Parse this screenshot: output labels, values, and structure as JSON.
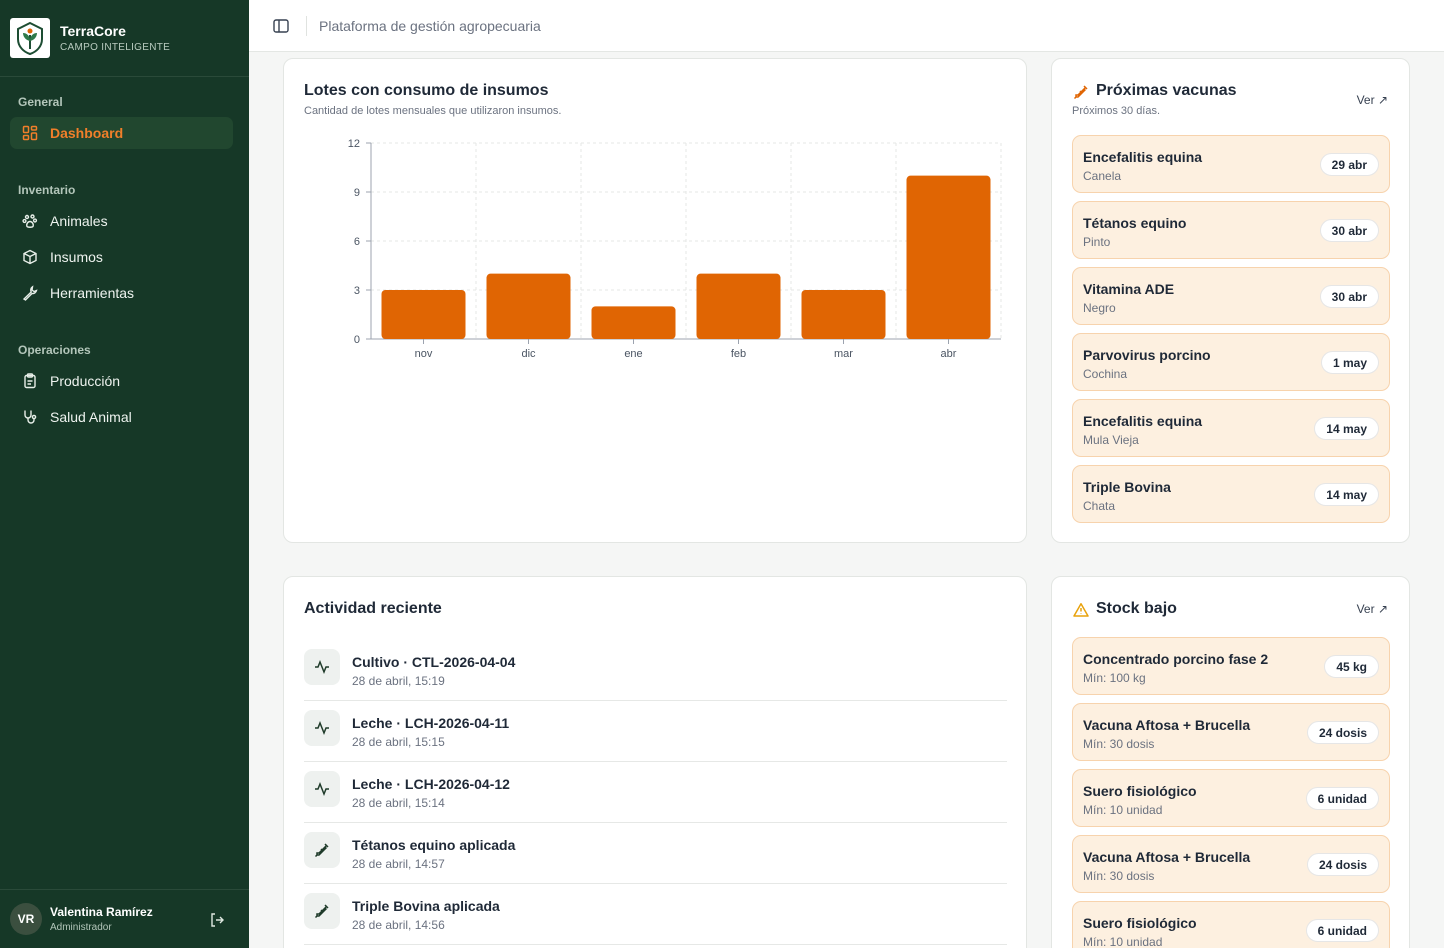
{
  "brand": {
    "name": "TerraCore",
    "tagline": "CAMPO INTELIGENTE"
  },
  "sidebar": {
    "sections": [
      {
        "title": "General",
        "items": [
          {
            "label": "Dashboard",
            "icon": "dashboard-icon",
            "active": true
          }
        ]
      },
      {
        "title": "Inventario",
        "items": [
          {
            "label": "Animales",
            "icon": "paw-icon"
          },
          {
            "label": "Insumos",
            "icon": "box-icon"
          },
          {
            "label": "Herramientas",
            "icon": "wrench-icon"
          }
        ]
      },
      {
        "title": "Operaciones",
        "items": [
          {
            "label": "Producción",
            "icon": "clipboard-icon"
          },
          {
            "label": "Salud Animal",
            "icon": "stethoscope-icon"
          }
        ]
      }
    ]
  },
  "user": {
    "initials": "VR",
    "name": "Valentina Ramírez",
    "role": "Administrador"
  },
  "header": {
    "title": "Plataforma de gestión agropecuaria"
  },
  "consumo": {
    "title": "Lotes con consumo de insumos",
    "subtitle": "Cantidad de lotes mensuales que utilizaron insumos."
  },
  "chart_data": {
    "type": "bar",
    "categories": [
      "nov",
      "dic",
      "ene",
      "feb",
      "mar",
      "abr"
    ],
    "values": [
      3,
      4,
      2,
      4,
      3,
      10
    ],
    "yticks": [
      0,
      3,
      6,
      9,
      12
    ],
    "ylim": [
      0,
      12
    ],
    "grid": true,
    "color": "#e06503"
  },
  "vacunas": {
    "title": "Próximas vacunas",
    "subtitle": "Próximos 30 días.",
    "link": "Ver ↗",
    "items": [
      {
        "name": "Encefalitis equina",
        "animal": "Canela",
        "date": "29 abr"
      },
      {
        "name": "Tétanos equino",
        "animal": "Pinto",
        "date": "30 abr"
      },
      {
        "name": "Vitamina ADE",
        "animal": "Negro",
        "date": "30 abr"
      },
      {
        "name": "Parvovirus porcino",
        "animal": "Cochina",
        "date": "1 may"
      },
      {
        "name": "Encefalitis equina",
        "animal": "Mula Vieja",
        "date": "14 may"
      },
      {
        "name": "Triple Bovina",
        "animal": "Chata",
        "date": "14 may"
      }
    ]
  },
  "actividad": {
    "title": "Actividad reciente",
    "items": [
      {
        "title": "Cultivo · CTL-2026-04-04",
        "date": "28 de abril, 15:19",
        "icon": "activity-icon"
      },
      {
        "title": "Leche · LCH-2026-04-11",
        "date": "28 de abril, 15:15",
        "icon": "activity-icon"
      },
      {
        "title": "Leche · LCH-2026-04-12",
        "date": "28 de abril, 15:14",
        "icon": "activity-icon"
      },
      {
        "title": "Tétanos equino aplicada",
        "date": "28 de abril, 14:57",
        "icon": "syringe-icon"
      },
      {
        "title": "Triple Bovina aplicada",
        "date": "28 de abril, 14:56",
        "icon": "syringe-icon"
      }
    ]
  },
  "stock": {
    "title": "Stock bajo",
    "link": "Ver ↗",
    "items": [
      {
        "name": "Concentrado porcino fase 2",
        "min": "Mín: 100 kg",
        "qty": "45 kg"
      },
      {
        "name": "Vacuna Aftosa + Brucella",
        "min": "Mín: 30 dosis",
        "qty": "24 dosis"
      },
      {
        "name": "Suero fisiológico",
        "min": "Mín: 10 unidad",
        "qty": "6 unidad"
      },
      {
        "name": "Vacuna Aftosa + Brucella",
        "min": "Mín: 30 dosis",
        "qty": "24 dosis"
      },
      {
        "name": "Suero fisiológico",
        "min": "Mín: 10 unidad",
        "qty": "6 unidad"
      }
    ]
  },
  "colors": {
    "sidebar": "#163827",
    "accent": "#e06503",
    "pill_bg": "#fdf0e0"
  }
}
